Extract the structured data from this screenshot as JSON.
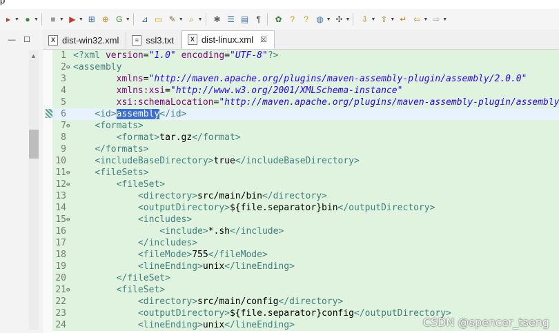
{
  "menu": {
    "fragment": "p"
  },
  "tabs": [
    {
      "label": "dist-win32.xml",
      "icon": "xml-file-icon",
      "icon_glyph": "X"
    },
    {
      "label": "ssl3.txt",
      "icon": "text-file-icon",
      "icon_glyph": "≡"
    },
    {
      "label": "dist-linux.xml",
      "icon": "xml-file-icon",
      "icon_glyph": "X",
      "active": true,
      "close": "☒"
    }
  ],
  "editor": {
    "current_line": 6,
    "selected_text": "assembly",
    "lines": [
      {
        "n": "1",
        "fold": "",
        "tokens": [
          [
            "t",
            "<?"
          ],
          [
            "t",
            "xml "
          ],
          [
            "a",
            "version"
          ],
          [
            "x",
            "="
          ],
          [
            "s",
            "\"1.0\""
          ],
          [
            "x",
            " "
          ],
          [
            "a",
            "encoding"
          ],
          [
            "x",
            "="
          ],
          [
            "s",
            "\"UTF-8\""
          ],
          [
            "t",
            "?>"
          ]
        ]
      },
      {
        "n": "2",
        "fold": "⊖",
        "tokens": [
          [
            "t",
            "<assembly"
          ]
        ]
      },
      {
        "n": "3",
        "fold": "",
        "tokens": [
          [
            "x",
            "        "
          ],
          [
            "a",
            "xmlns"
          ],
          [
            "x",
            "="
          ],
          [
            "s",
            "\"http://maven.apache.org/plugins/maven-assembly-plugin/assembly/2.0.0\""
          ]
        ]
      },
      {
        "n": "4",
        "fold": "",
        "tokens": [
          [
            "x",
            "        "
          ],
          [
            "a",
            "xmlns:xsi"
          ],
          [
            "x",
            "="
          ],
          [
            "s",
            "\"http://www.w3.org/2001/XMLSchema-instance\""
          ]
        ]
      },
      {
        "n": "5",
        "fold": "",
        "tokens": [
          [
            "x",
            "        "
          ],
          [
            "a",
            "xsi:schemaLocation"
          ],
          [
            "x",
            "="
          ],
          [
            "s",
            "\"http://maven.apache.org/plugins/maven-assembly-plugin/assembly\""
          ]
        ]
      },
      {
        "n": "6",
        "fold": "",
        "tokens": [
          [
            "x",
            "    "
          ],
          [
            "t",
            "<id>"
          ],
          [
            "hl",
            "assembly"
          ],
          [
            "t",
            "</id>"
          ]
        ]
      },
      {
        "n": "7",
        "fold": "⊖",
        "tokens": [
          [
            "x",
            "    "
          ],
          [
            "t",
            "<formats>"
          ]
        ]
      },
      {
        "n": "8",
        "fold": "",
        "tokens": [
          [
            "x",
            "        "
          ],
          [
            "t",
            "<format>"
          ],
          [
            "x",
            "tar.gz"
          ],
          [
            "t",
            "</format>"
          ]
        ]
      },
      {
        "n": "9",
        "fold": "",
        "tokens": [
          [
            "x",
            "    "
          ],
          [
            "t",
            "</formats>"
          ]
        ]
      },
      {
        "n": "10",
        "fold": "",
        "tokens": [
          [
            "x",
            "    "
          ],
          [
            "t",
            "<includeBaseDirectory>"
          ],
          [
            "x",
            "true"
          ],
          [
            "t",
            "</includeBaseDirectory>"
          ]
        ]
      },
      {
        "n": "11",
        "fold": "⊖",
        "tokens": [
          [
            "x",
            "    "
          ],
          [
            "t",
            "<fileSets>"
          ]
        ]
      },
      {
        "n": "12",
        "fold": "⊖",
        "tokens": [
          [
            "x",
            "        "
          ],
          [
            "t",
            "<fileSet>"
          ]
        ]
      },
      {
        "n": "13",
        "fold": "",
        "tokens": [
          [
            "x",
            "            "
          ],
          [
            "t",
            "<directory>"
          ],
          [
            "x",
            "src/main/bin"
          ],
          [
            "t",
            "</directory>"
          ]
        ]
      },
      {
        "n": "14",
        "fold": "",
        "tokens": [
          [
            "x",
            "            "
          ],
          [
            "t",
            "<outputDirectory>"
          ],
          [
            "x",
            "${file.separator}bin"
          ],
          [
            "t",
            "</outputDirectory>"
          ]
        ]
      },
      {
        "n": "15",
        "fold": "⊖",
        "tokens": [
          [
            "x",
            "            "
          ],
          [
            "t",
            "<includes>"
          ]
        ]
      },
      {
        "n": "16",
        "fold": "",
        "tokens": [
          [
            "x",
            "                "
          ],
          [
            "t",
            "<include>"
          ],
          [
            "x",
            "*.sh"
          ],
          [
            "t",
            "</include>"
          ]
        ]
      },
      {
        "n": "17",
        "fold": "",
        "tokens": [
          [
            "x",
            "            "
          ],
          [
            "t",
            "</includes>"
          ]
        ]
      },
      {
        "n": "18",
        "fold": "",
        "tokens": [
          [
            "x",
            "            "
          ],
          [
            "t",
            "<fileMode>"
          ],
          [
            "x",
            "755"
          ],
          [
            "t",
            "</fileMode>"
          ]
        ]
      },
      {
        "n": "19",
        "fold": "",
        "tokens": [
          [
            "x",
            "            "
          ],
          [
            "t",
            "<lineEnding>"
          ],
          [
            "x",
            "unix"
          ],
          [
            "t",
            "</lineEnding>"
          ]
        ]
      },
      {
        "n": "20",
        "fold": "",
        "tokens": [
          [
            "x",
            "        "
          ],
          [
            "t",
            "</fileSet>"
          ]
        ]
      },
      {
        "n": "21",
        "fold": "⊖",
        "tokens": [
          [
            "x",
            "        "
          ],
          [
            "t",
            "<fileSet>"
          ]
        ]
      },
      {
        "n": "22",
        "fold": "",
        "tokens": [
          [
            "x",
            "            "
          ],
          [
            "t",
            "<directory>"
          ],
          [
            "x",
            "src/main/config"
          ],
          [
            "t",
            "</directory>"
          ]
        ]
      },
      {
        "n": "23",
        "fold": "",
        "tokens": [
          [
            "x",
            "            "
          ],
          [
            "t",
            "<outputDirectory>"
          ],
          [
            "x",
            "${file.separator}config"
          ],
          [
            "t",
            "</outputDirectory>"
          ]
        ]
      },
      {
        "n": "24",
        "fold": "",
        "tokens": [
          [
            "x",
            "            "
          ],
          [
            "t",
            "<lineEnding>"
          ],
          [
            "x",
            "unix"
          ],
          [
            "t",
            "</lineEnding>"
          ]
        ]
      }
    ]
  },
  "toolbar": [
    {
      "name": "skip-all-breakpoints-icon",
      "glyph": "▸",
      "color": "#c0392b",
      "drop": true
    },
    {
      "name": "run-icon",
      "glyph": "●",
      "color": "#2e8b2e",
      "drop": true
    },
    {
      "sep": true
    },
    {
      "name": "stop-icon",
      "glyph": "■",
      "color": "#9a9a9a",
      "drop": true
    },
    {
      "name": "external-tools-icon",
      "glyph": "▶",
      "color": "#c0392b",
      "drop": true
    },
    {
      "name": "new-java-project-icon",
      "glyph": "⊞",
      "color": "#3a6ea5",
      "drop": false
    },
    {
      "name": "new-package-icon",
      "glyph": "⊕",
      "color": "#c28a1e",
      "drop": false
    },
    {
      "name": "new-class-icon",
      "glyph": "G",
      "color": "#2e8b2e",
      "drop": true
    },
    {
      "sep": true
    },
    {
      "name": "open-type-icon",
      "glyph": "⊿",
      "color": "#3a6ea5",
      "drop": false
    },
    {
      "name": "open-folder-icon",
      "glyph": "▭",
      "color": "#d4a017",
      "drop": false
    },
    {
      "name": "open-task-icon",
      "glyph": "✎",
      "color": "#8b6b3d",
      "drop": true
    },
    {
      "name": "search-icon",
      "glyph": "⌕",
      "color": "#c28a1e",
      "drop": true
    },
    {
      "sep": true
    },
    {
      "name": "annotation-icon",
      "glyph": "✱",
      "color": "#666666",
      "drop": false
    },
    {
      "name": "toggle-mark-icon",
      "glyph": "☰",
      "color": "#3a6ea5",
      "drop": false
    },
    {
      "name": "block-selection-icon",
      "glyph": "▤",
      "color": "#3a6ea5",
      "drop": false
    },
    {
      "name": "show-whitespace-icon",
      "glyph": "¶",
      "color": "#555555",
      "drop": false
    },
    {
      "sep": true
    },
    {
      "name": "gear-tool-icon",
      "glyph": "✿",
      "color": "#2e7d32",
      "drop": false
    },
    {
      "name": "help-icon",
      "glyph": "?",
      "color": "#d4a017",
      "drop": false
    },
    {
      "name": "help-contents-icon",
      "glyph": "?",
      "color": "#d4a017",
      "drop": false
    },
    {
      "name": "web-browser-icon",
      "glyph": "◍",
      "color": "#3a6ea5",
      "drop": true
    },
    {
      "name": "debug-tools-icon",
      "glyph": "✣",
      "color": "#555555",
      "drop": true
    },
    {
      "sep": true
    },
    {
      "name": "next-annotation-icon",
      "glyph": "⇩",
      "color": "#c28a1e",
      "drop": true
    },
    {
      "name": "previous-annotation-icon",
      "glyph": "⇧",
      "color": "#c28a1e",
      "drop": true
    },
    {
      "name": "last-edit-location-icon",
      "glyph": "↵",
      "color": "#c28a1e",
      "drop": false
    },
    {
      "name": "back-icon",
      "glyph": "⇦",
      "color": "#c28a1e",
      "drop": true
    },
    {
      "name": "forward-icon",
      "glyph": "⇨",
      "color": "#9a9a9a",
      "drop": true
    }
  ],
  "left_panel": {
    "minimize": "—",
    "maximize": "☐",
    "scroll_up": "▲"
  },
  "watermark": "CSDN @spencer_tseng"
}
